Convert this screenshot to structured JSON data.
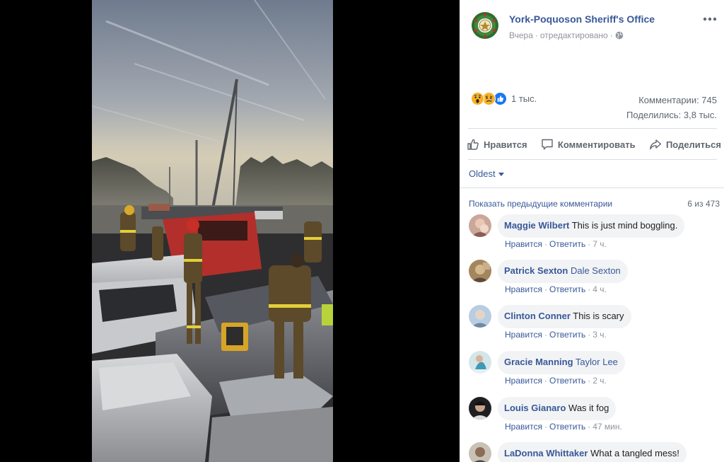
{
  "page": {
    "name": "York-Poquoson Sheriff's Office",
    "time": "Вчера",
    "edited": "отредактировано",
    "separator": "·"
  },
  "reactions": {
    "icons": [
      "wow-icon",
      "sad-icon",
      "like-icon"
    ],
    "count": "1 тыс."
  },
  "stats": {
    "comments": "Комментарии: 745",
    "shares": "Поделились: 3,8 тыс."
  },
  "actions": {
    "like": "Нравится",
    "comment": "Комментировать",
    "share": "Поделиться"
  },
  "sort": {
    "selected": "Oldest"
  },
  "previous": {
    "link": "Показать предыдущие комментарии",
    "count": "6 из 473"
  },
  "comment_actions": {
    "like": "Нравится",
    "reply": "Ответить",
    "dot": "·"
  },
  "comments": [
    {
      "author": "Maggie Wilbert",
      "tag": "",
      "text": "This is just mind boggling.",
      "time": "7 ч."
    },
    {
      "author": "Patrick Sexton",
      "tag": "Dale Sexton",
      "text": "",
      "time": "4 ч."
    },
    {
      "author": "Clinton Conner",
      "tag": "",
      "text": "This is scary",
      "time": "3 ч."
    },
    {
      "author": "Gracie Manning",
      "tag": "Taylor Lee",
      "text": "",
      "time": "2 ч."
    },
    {
      "author": "Louis Gianaro",
      "tag": "",
      "text": "Was it fog",
      "time": "47 мин."
    },
    {
      "author": "LaDonna Whittaker",
      "tag": "",
      "text": "What a tangled mess!",
      "time": ""
    }
  ],
  "colors": {
    "link": "#385898",
    "meta": "#90949c",
    "bubble": "#f2f3f5",
    "like_blue": "#1877f2",
    "reaction_yellow": "#f7b125"
  }
}
